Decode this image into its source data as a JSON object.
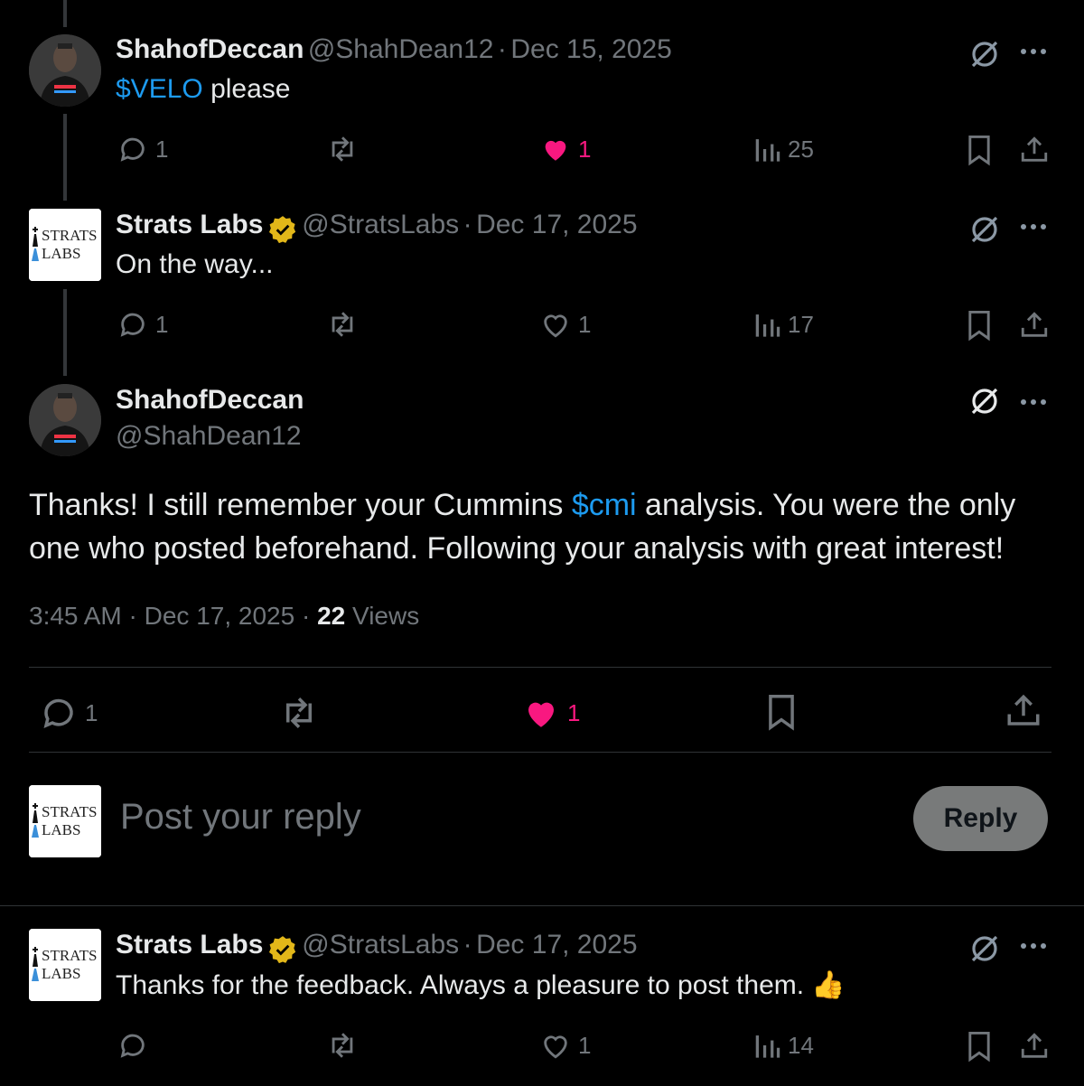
{
  "tweet1": {
    "display_name": "ShahofDeccan",
    "handle": "@ShahDean12",
    "date": "Dec 15, 2025",
    "text_cashtag": "$VELO",
    "text_rest": " please",
    "replies": "1",
    "likes": "1",
    "views": "25",
    "liked": true,
    "avatar_shirt_text": "NO HABLO\nLIBTARD"
  },
  "tweet2": {
    "display_name": "Strats Labs",
    "handle": "@StratsLabs",
    "date": "Dec 17, 2025",
    "text": "On the way...",
    "replies": "1",
    "likes": "1",
    "views": "17",
    "logo_line1": "STRATS",
    "logo_line2": "LABS"
  },
  "main_tweet": {
    "display_name": "ShahofDeccan",
    "handle": "@ShahDean12",
    "text_before": "Thanks! I still remember your Cummins ",
    "text_cashtag": "$cmi",
    "text_after": " analysis. You were the only one who posted beforehand. Following your analysis with great interest!",
    "time": "3:45 AM",
    "date": "Dec 17, 2025",
    "views_count": "22",
    "views_label": "Views",
    "replies": "1",
    "likes": "1",
    "liked": true
  },
  "composer": {
    "placeholder": "Post your reply",
    "reply_button": "Reply"
  },
  "tweet3": {
    "display_name": "Strats Labs",
    "handle": "@StratsLabs",
    "date": "Dec 17, 2025",
    "text": "Thanks for the feedback. Always a pleasure to post them. 👍",
    "likes": "1",
    "views": "14"
  },
  "separator": "·",
  "colors": {
    "background": "#000000",
    "text": "#e7e9ea",
    "muted": "#71767b",
    "link": "#1d9bf0",
    "like": "#f91880",
    "verified": "#e2b719",
    "reply_button_bg": "#787a7a"
  },
  "icons": [
    "reply-icon",
    "repost-icon",
    "like-icon",
    "views-icon",
    "bookmark-icon",
    "share-icon",
    "grok-icon",
    "more-icon",
    "verified-badge-icon"
  ]
}
